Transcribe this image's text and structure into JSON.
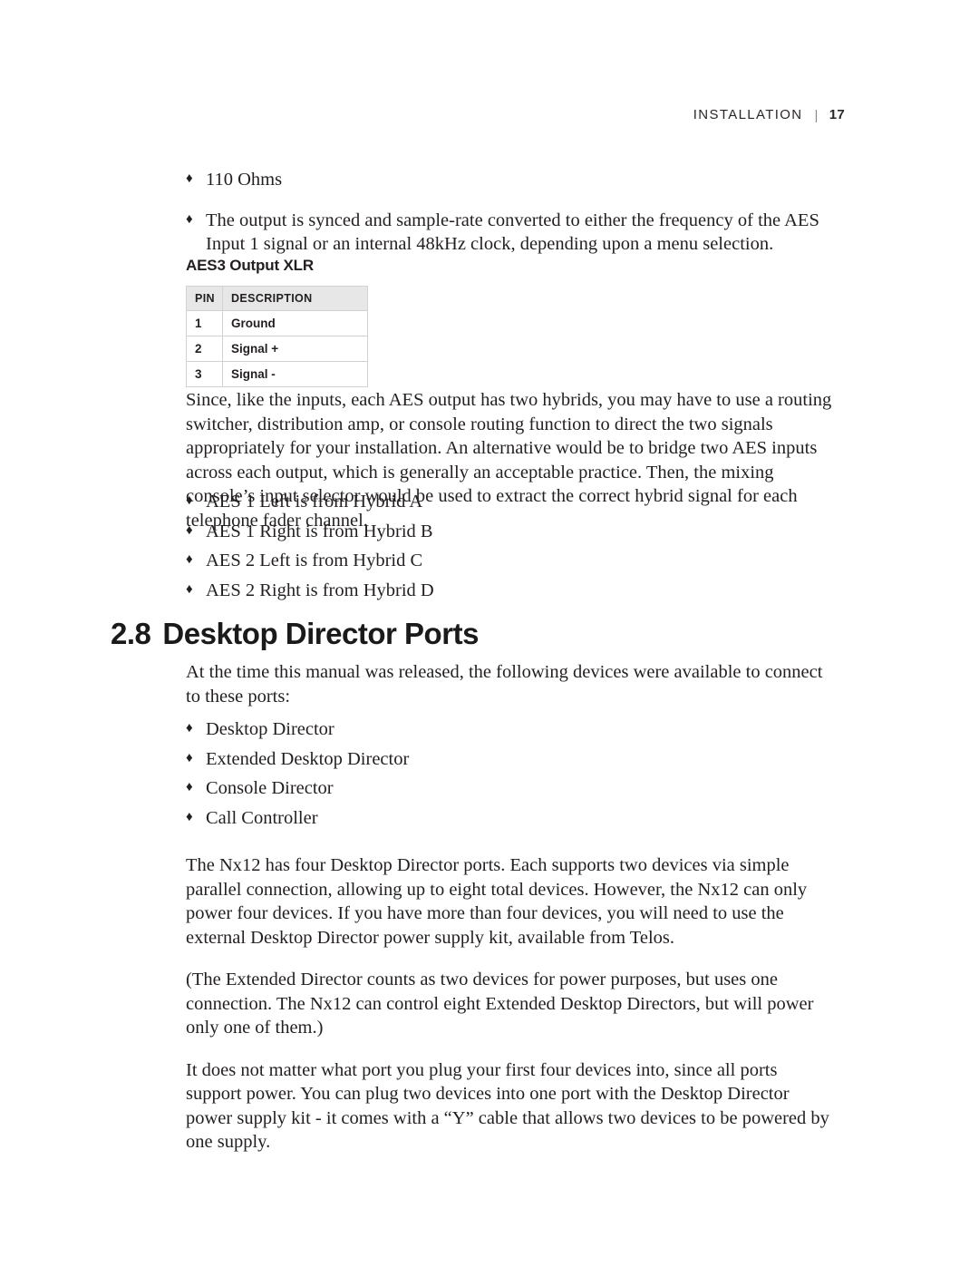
{
  "header": {
    "section_label": "INSTALLATION",
    "separator": "|",
    "page_number": "17"
  },
  "top_bullets": [
    "110 Ohms",
    "The output is synced and sample-rate converted to either the frequency of the AES Input 1 signal or an internal 48kHz clock, depending upon a menu selection."
  ],
  "xlr_table": {
    "title": "AES3 Output XLR",
    "columns": [
      "PIN",
      "DESCRIPTION"
    ],
    "rows": [
      {
        "pin": "1",
        "description": "Ground"
      },
      {
        "pin": "2",
        "description": "Signal +"
      },
      {
        "pin": "3",
        "description": "Signal -"
      }
    ]
  },
  "paragraph_since": "Since, like the inputs, each AES output has two hybrids, you may have to use a routing switcher, distribution amp, or console routing function to direct the two signals appropriately for your installation. An alternative would be to bridge two AES inputs across each output, which is generally an acceptable practice. Then, the mixing console’s input selector would be used to extract the correct hybrid signal for each telephone fader channel.",
  "hybrid_bullets": [
    "AES 1 Left is from Hybrid A",
    "AES 1 Right is from Hybrid B",
    "AES 2 Left is from Hybrid C",
    "AES 2 Right is from Hybrid D"
  ],
  "section": {
    "number": "2.8",
    "title": "Desktop Director Ports"
  },
  "intro_paragraph": "At the time this manual was released, the following devices were available to connect to these ports:",
  "device_bullets": [
    "Desktop Director",
    "Extended Desktop Director",
    "Console Director",
    "Call Controller"
  ],
  "paragraph_ports": "The Nx12 has four Desktop Director ports. Each supports two devices via simple parallel connection, allowing up to eight total devices. However, the Nx12 can only power four devices. If you have more than four devices, you will need to use the external Desktop Director power supply kit, available from Telos.",
  "paragraph_extended": "(The Extended Director counts as two devices for power purposes, but uses one connection. The Nx12 can control eight Extended Desktop Directors, but will power only one of them.)",
  "paragraph_plug": "It does not matter what port you plug your first four devices into, since all ports support power. You can plug two devices into one port with the Desktop Director power supply kit - it comes with a “Y” cable that allows two devices to be powered by one supply.",
  "glyphs": {
    "bullet": "♦"
  },
  "colors": {
    "text": "#231f20",
    "table_header_bg": "#e7e7e8",
    "table_border": "#d2d2d2",
    "heading": "#1a1a1a"
  }
}
